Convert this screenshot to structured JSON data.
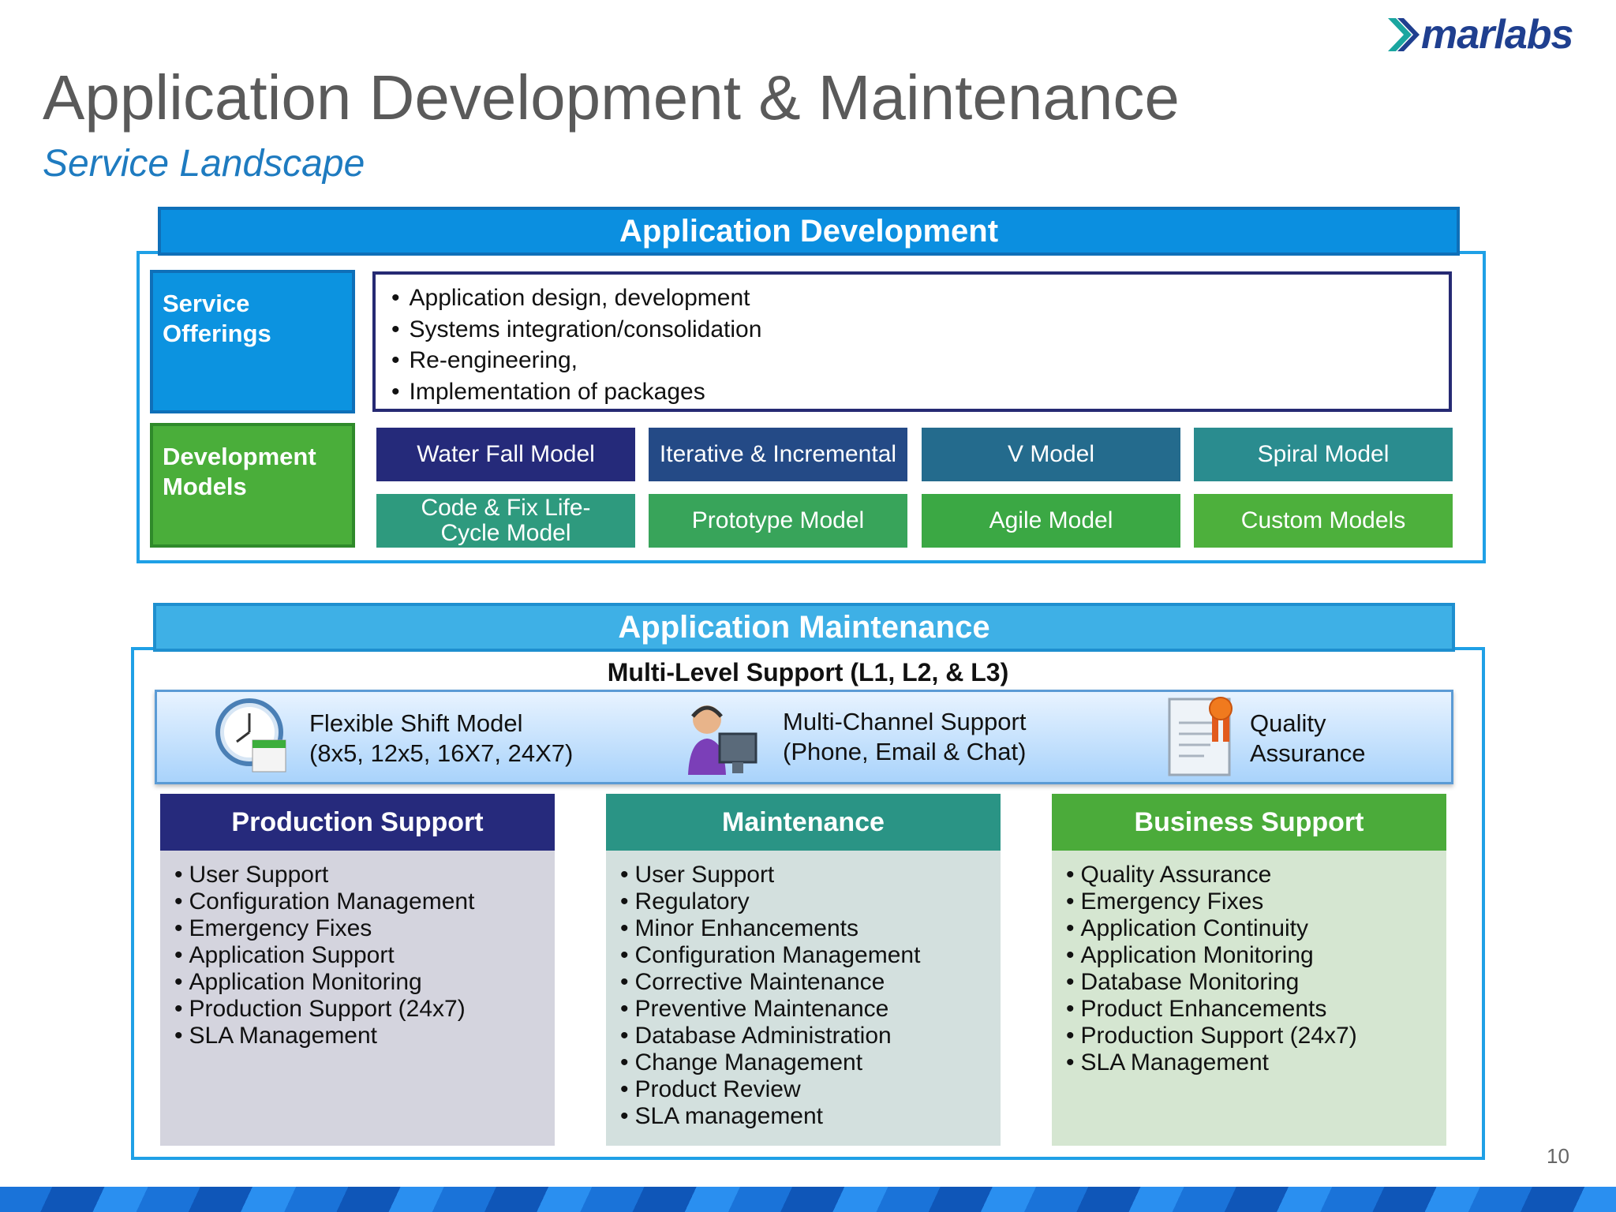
{
  "header": {
    "logo_text": "marlabs",
    "title": "Application Development & Maintenance",
    "subtitle": "Service Landscape"
  },
  "development": {
    "banner": "Application Development",
    "service_offerings_label": "Service Offerings",
    "offerings": [
      "Application design, development",
      "Systems integration/consolidation",
      "Re-engineering,",
      "Implementation of packages"
    ],
    "development_models_label": "Development Models",
    "models": [
      {
        "label": "Water Fall Model",
        "color": "#252a7a"
      },
      {
        "label": "Iterative & Incremental",
        "color": "#244a86"
      },
      {
        "label": "V Model",
        "color": "#246b8d"
      },
      {
        "label": "Spiral Model",
        "color": "#2a8c8f"
      },
      {
        "label": "Code & Fix Life-Cycle Model",
        "color": "#2e9a7e"
      },
      {
        "label": "Prototype Model",
        "color": "#38a45a"
      },
      {
        "label": "Agile Model",
        "color": "#3ba844"
      },
      {
        "label": "Custom Models",
        "color": "#4db03c"
      }
    ]
  },
  "maintenance": {
    "banner": "Application Maintenance",
    "multi_level": "Multi-Level Support (L1, L2, & L3)",
    "features": {
      "shift": {
        "line1": "Flexible Shift Model",
        "line2": "(8x5, 12x5, 16X7, 24X7)"
      },
      "channel": {
        "line1": "Multi-Channel Support",
        "line2": "(Phone, Email & Chat)"
      },
      "quality": {
        "line1": "Quality",
        "line2": "Assurance"
      }
    },
    "columns": [
      {
        "title": "Production Support",
        "header_color": "#262a7c",
        "body_color": "#d4d4de",
        "items": [
          "User Support",
          "Configuration Management",
          "Emergency Fixes",
          "Application Support",
          "Application Monitoring",
          "Production Support (24x7)",
          "SLA Management"
        ]
      },
      {
        "title": "Maintenance",
        "header_color": "#2a9485",
        "body_color": "#d3e0de",
        "items": [
          "User Support",
          "Regulatory",
          "Minor Enhancements",
          "Configuration Management",
          "Corrective Maintenance",
          "Preventive Maintenance",
          "Database Administration",
          "Change Management",
          "Product Review",
          "SLA management"
        ]
      },
      {
        "title": "Business Support",
        "header_color": "#4bab3a",
        "body_color": "#d5e6d1",
        "items": [
          "Quality Assurance",
          "Emergency Fixes",
          "Application Continuity",
          "Application Monitoring",
          "Database Monitoring",
          "Product Enhancements",
          "Production Support (24x7)",
          "SLA Management"
        ]
      }
    ]
  },
  "page_number": "10"
}
